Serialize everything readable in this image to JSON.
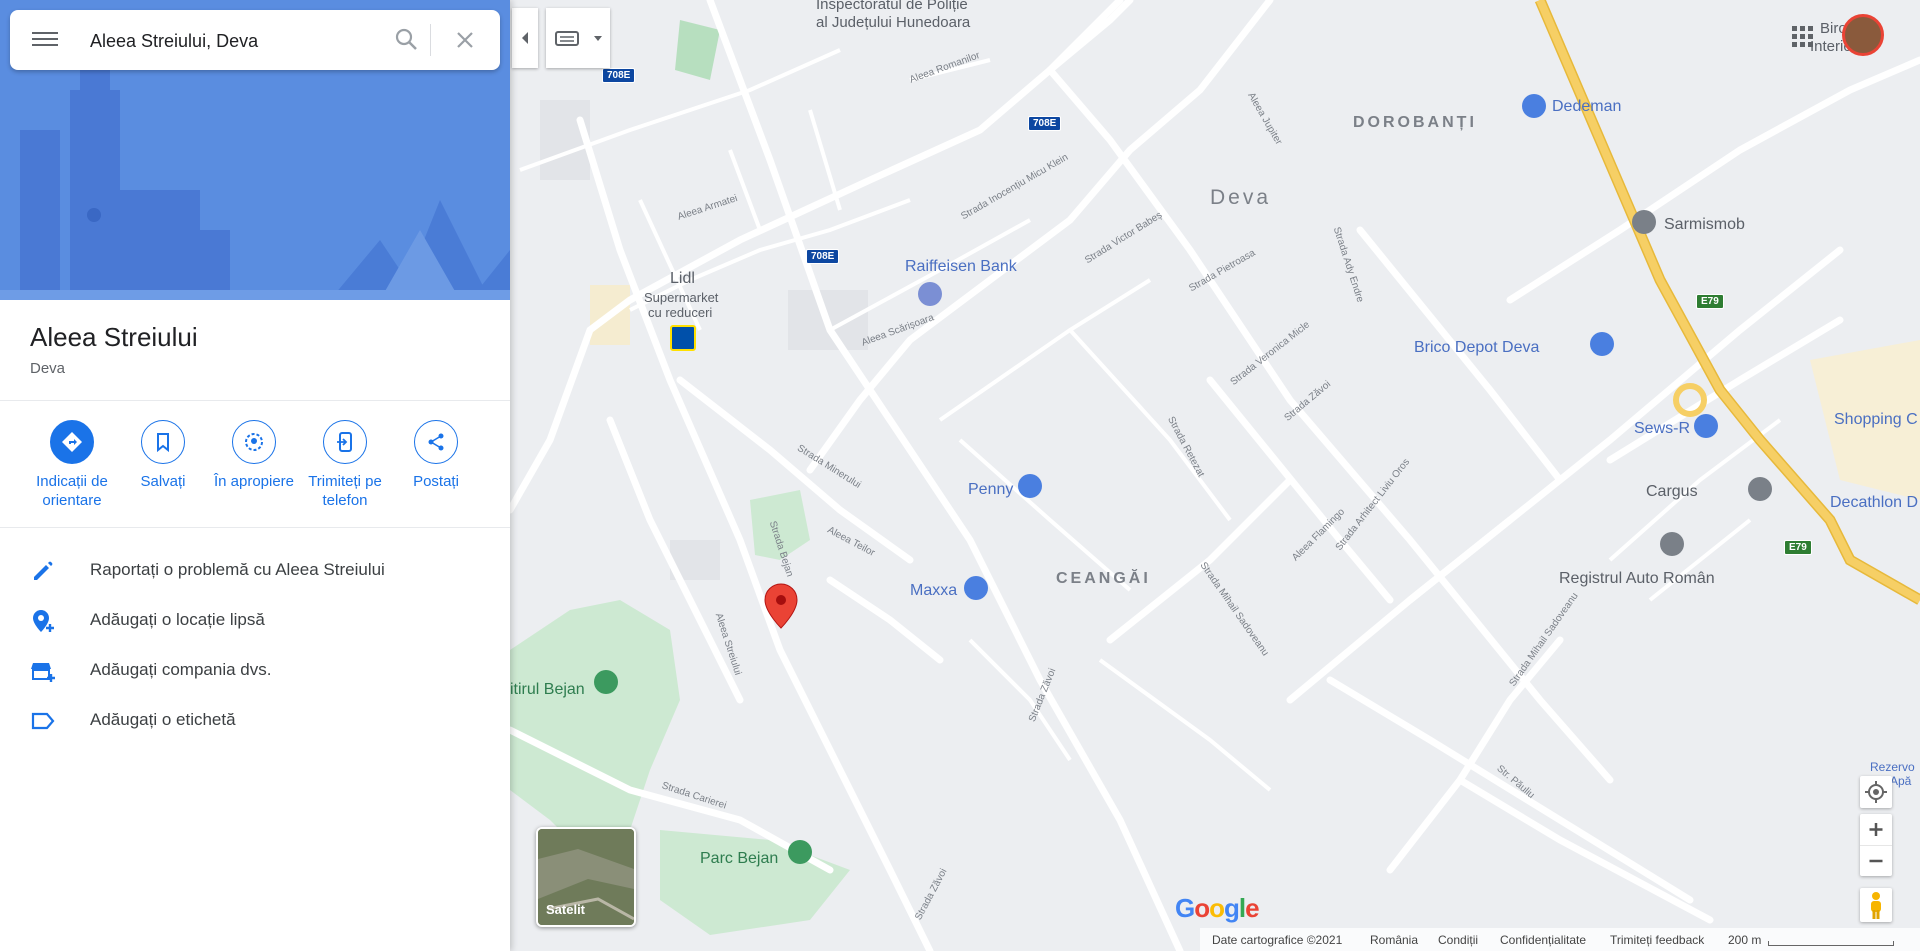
{
  "search": {
    "value": "Aleea Streiului, Deva"
  },
  "place": {
    "title": "Aleea Streiului",
    "subtitle": "Deva"
  },
  "actions": [
    {
      "label": "Indicații de orientare",
      "icon": "directions-icon"
    },
    {
      "label": "Salvați",
      "icon": "bookmark-icon"
    },
    {
      "label": "În apropiere",
      "icon": "nearby-icon"
    },
    {
      "label": "Trimiteți pe telefon",
      "icon": "send-to-phone-icon"
    },
    {
      "label": "Postați",
      "icon": "share-icon"
    }
  ],
  "menu_rows": [
    {
      "label": "Raportați o problemă cu Aleea Streiului",
      "icon": "pencil-icon"
    },
    {
      "label": "Adăugați o locație lipsă",
      "icon": "add-location-icon"
    },
    {
      "label": "Adăugați compania dvs.",
      "icon": "add-business-icon"
    },
    {
      "label": "Adăugați o etichetă",
      "icon": "label-icon"
    }
  ],
  "map": {
    "pois": {
      "lidl": "Lidl",
      "lidl_sub1": "Supermarket",
      "lidl_sub2": "cu reduceri",
      "raiffeisen": "Raiffeisen Bank",
      "penny": "Penny",
      "maxxa": "Maxxa",
      "dedeman": "Dedeman",
      "sarmismob": "Sarmismob",
      "brico": "Brico Depot Deva",
      "sewsr": "Sews-R",
      "cargus": "Cargus",
      "shopping": "Shopping C",
      "decathlon": "Decathlon D",
      "registrul": "Registrul Auto Român",
      "bejan_site": "itirul Bejan",
      "parc_bejan": "Parc Bejan",
      "inspectorat1": "Inspectoratul de Poliție",
      "inspectorat2": "al Județului Hunedoara",
      "rezervor1": "Rezervo",
      "rezervor2": "Apă",
      "birou1": "Biro",
      "birou2": "Interio"
    },
    "areas": {
      "city": "Deva",
      "dorobanti": "DOROBANȚI",
      "ceangai": "CEANGĂI"
    },
    "streets": {
      "romanilor": "Aleea Romanilor",
      "armatei": "Aleea Armatei",
      "micu": "Strada Inocențiu Micu Klein",
      "babes": "Strada Victor Babeș",
      "pietroasa": "Strada Pietroasa",
      "ady": "Strada Ady Endre",
      "jupiter": "Aleea Jupiter",
      "scarisoara": "Aleea Scărișoara",
      "minerului": "Strada Minerului",
      "bejan": "Strada Bejan",
      "teilor": "Aleea Teilor",
      "streiului": "Aleea Streiului",
      "retezat": "Strada Retezat",
      "veronica": "Strada Veronica Micle",
      "zavoi": "Strada Zăvoi",
      "sadoveanu": "Strada Mihail Sadoveanu",
      "flamingo": "Aleea Flamingo",
      "oros": "Strada Arhitect Liviu Oros",
      "carierei": "Strada Carierei",
      "pauliu": "Str. Păuliu"
    },
    "shields": {
      "r708e": "708E",
      "e79": "E79"
    }
  },
  "satellite_label": "Satelit",
  "google_logo": "Google",
  "footer": {
    "data": "Date cartografice ©2021",
    "country": "România",
    "terms": "Condiții",
    "privacy": "Confidențialitate",
    "feedback": "Trimiteți feedback",
    "scale": "200 m"
  },
  "colors": {
    "accent": "#1a73e8",
    "hero": "#5b8ee0",
    "pin_red": "#ea4335",
    "highway": "#f6cf65"
  }
}
